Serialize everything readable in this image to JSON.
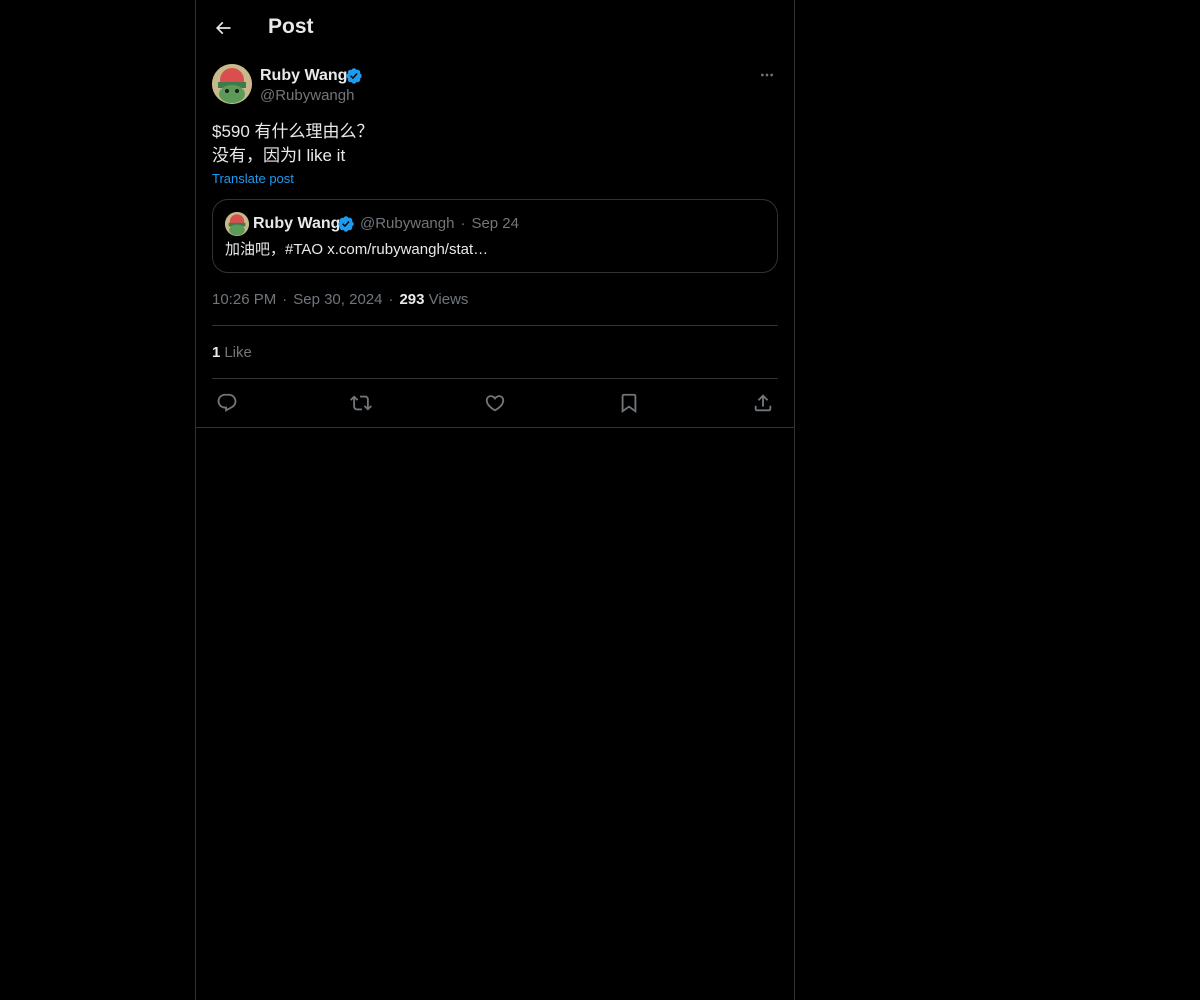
{
  "header": {
    "title": "Post",
    "back_icon": "arrow-left-icon"
  },
  "post": {
    "author": {
      "name": "Ruby Wang",
      "handle": "@Rubywangh",
      "verified": true
    },
    "text_lines": [
      "$590 有什么理由么？",
      "没有，因为I like it"
    ],
    "translate_label": "Translate post",
    "quote": {
      "author_name": "Ruby Wang",
      "author_handle": "@Rubywangh",
      "separator": "·",
      "date": "Sep 24",
      "text": "加油吧，#TAO x.com/rubywangh/stat…"
    },
    "time": "10:26 PM",
    "date": "Sep 30, 2024",
    "separator": "·",
    "views_count": "293",
    "views_label": "Views",
    "likes_count": "1",
    "likes_label": "Like"
  },
  "actions": [
    {
      "name": "reply",
      "icon": "reply-icon"
    },
    {
      "name": "repost",
      "icon": "repost-icon"
    },
    {
      "name": "like",
      "icon": "heart-icon"
    },
    {
      "name": "bookmark",
      "icon": "bookmark-icon"
    },
    {
      "name": "share",
      "icon": "share-icon"
    }
  ],
  "colors": {
    "background": "#000000",
    "text": "#e7e9ea",
    "muted": "#71767b",
    "border": "#2f3336",
    "accent": "#1d9bf0"
  }
}
